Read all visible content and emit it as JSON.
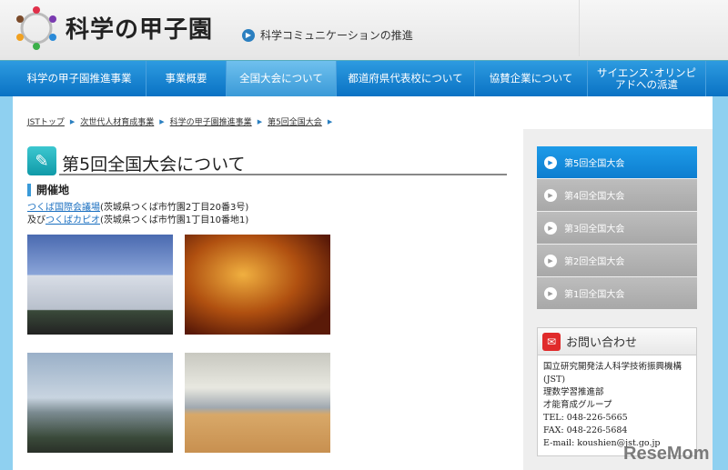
{
  "header": {
    "logo": "科学の甲子園",
    "tagline": "科学コミュニケーションの推進"
  },
  "nav": [
    "科学の甲子園推進事業",
    "事業概要",
    "全国大会について",
    "都道府県代表校について",
    "協賛企業について",
    "サイエンス･オリンピアドへの派遣"
  ],
  "breadcrumb": [
    "JSTトップ",
    "次世代人材育成事業",
    "科学の甲子園推進事業",
    "第5回全国大会"
  ],
  "main": {
    "title": "第5回全国大会について",
    "section": "開催地",
    "venue1_link": "つくば国際会議場",
    "venue1_addr": "(茨城県つくば市竹園2丁目20番3号)",
    "venue2_prefix": "及び",
    "venue2_link": "つくばカピオ",
    "venue2_addr": "(茨城県つくば市竹園1丁目10番地1)"
  },
  "sidebar": {
    "items": [
      "第5回全国大会",
      "第4回全国大会",
      "第3回全国大会",
      "第2回全国大会",
      "第1回全国大会"
    ],
    "contact_title": "お問い合わせ",
    "contact_lines": [
      "国立研究開発法人科学技術振興機構(JST)",
      "理数学習推進部",
      "才能育成グループ",
      "TEL: 048-226-5665",
      "FAX: 048-226-5684",
      "E-mail: koushien@jst.go.jp"
    ]
  },
  "watermark": "ReseMom"
}
